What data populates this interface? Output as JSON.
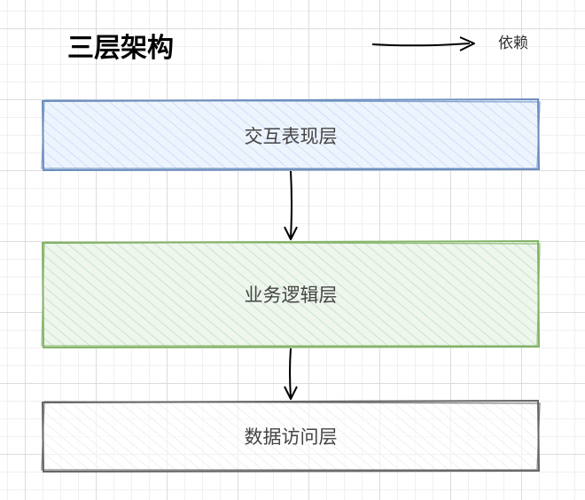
{
  "title": "三层架构",
  "legend": {
    "label": "依赖"
  },
  "layers": [
    {
      "label": "交互表现层",
      "stroke": "#6c8ebf",
      "fill": "#dae8fc"
    },
    {
      "label": "业务逻辑层",
      "stroke": "#82b366",
      "fill": "#d5e8d4"
    },
    {
      "label": "数据访问层",
      "stroke": "#666666",
      "fill": "#f5f5f5"
    }
  ],
  "edges": [
    {
      "from": "交互表现层",
      "to": "业务逻辑层",
      "label": ""
    },
    {
      "from": "业务逻辑层",
      "to": "数据访问层",
      "label": ""
    }
  ]
}
